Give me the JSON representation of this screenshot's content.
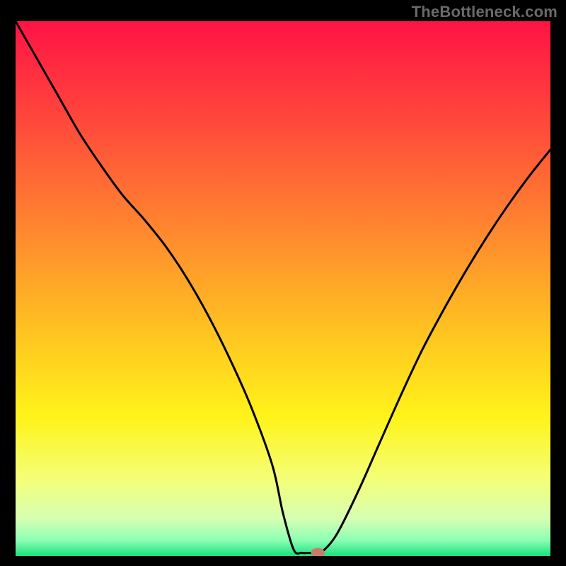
{
  "watermark": {
    "text": "TheBottleneck.com"
  },
  "chart_data": {
    "type": "line",
    "title": "",
    "xlabel": "",
    "ylabel": "",
    "xlim": [
      0,
      100
    ],
    "ylim": [
      0,
      100
    ],
    "grid": false,
    "legend": false,
    "background_gradient": {
      "stops": [
        {
          "offset": 0.0,
          "color": "#ff1345"
        },
        {
          "offset": 0.2,
          "color": "#ff4c3a"
        },
        {
          "offset": 0.4,
          "color": "#ff8a2e"
        },
        {
          "offset": 0.58,
          "color": "#ffc321"
        },
        {
          "offset": 0.74,
          "color": "#fff31a"
        },
        {
          "offset": 0.86,
          "color": "#f3ff7a"
        },
        {
          "offset": 0.93,
          "color": "#d6ffb2"
        },
        {
          "offset": 0.97,
          "color": "#8dffb5"
        },
        {
          "offset": 1.0,
          "color": "#18e07a"
        }
      ]
    },
    "series": [
      {
        "name": "bottleneck-curve",
        "color": "#000000",
        "width": 3,
        "x": [
          0,
          4,
          8,
          12,
          16,
          20,
          24,
          28,
          32,
          36,
          40,
          44,
          48,
          50,
          52,
          53.5,
          55,
          57,
          60,
          64,
          68,
          72,
          76,
          80,
          84,
          88,
          92,
          96,
          100
        ],
        "y": [
          100,
          93,
          86,
          79,
          73,
          67.5,
          63,
          58,
          52,
          45,
          37,
          28,
          17,
          8,
          1.2,
          0.6,
          0.6,
          0.6,
          4,
          12,
          21,
          30,
          38.5,
          46,
          53,
          59.5,
          65.5,
          71,
          76
        ]
      }
    ],
    "marker": {
      "name": "optimal-point",
      "x": 56.5,
      "y": 0.6,
      "rx": 1.3,
      "ry": 0.9,
      "color": "#c97a6a"
    }
  }
}
